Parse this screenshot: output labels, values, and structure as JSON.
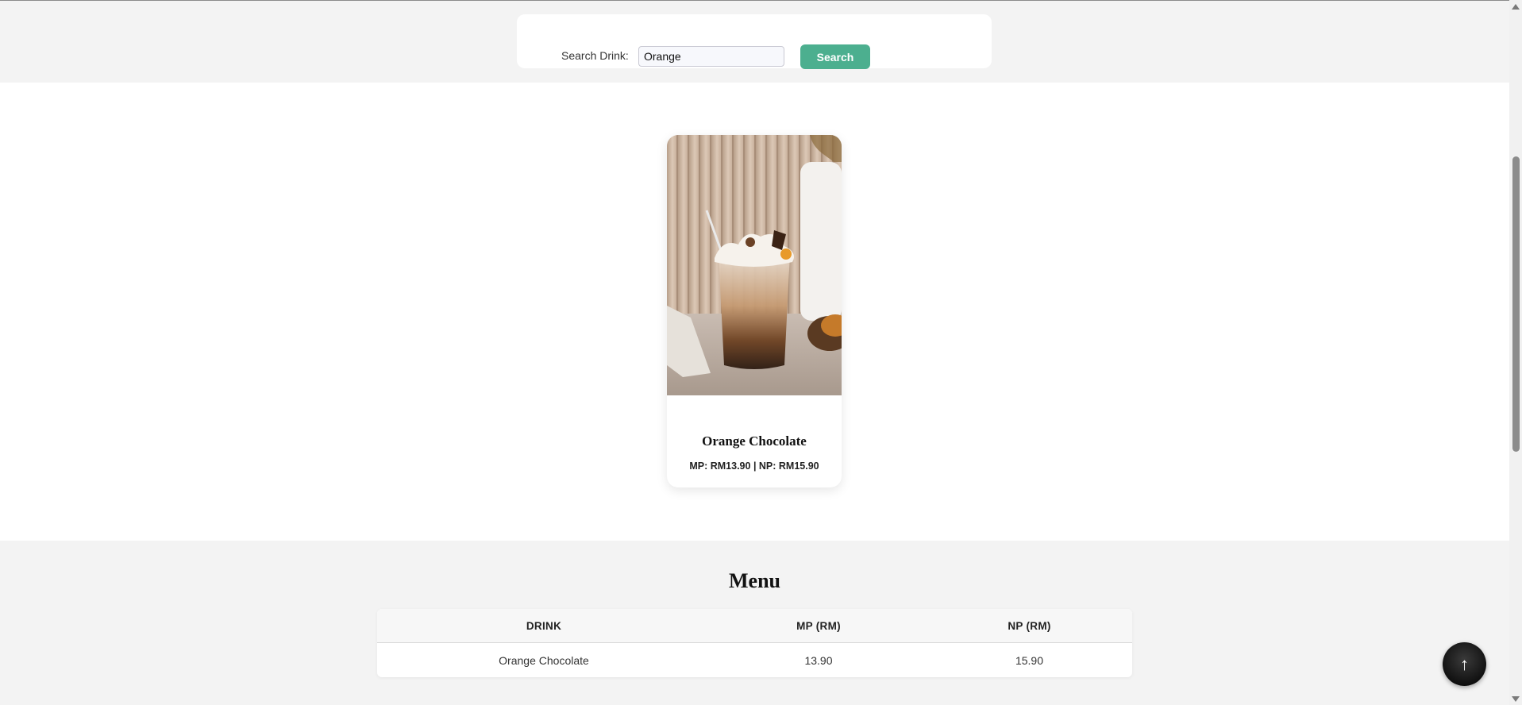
{
  "search": {
    "label": "Search Drink:",
    "value": "Orange",
    "button_label": "Search"
  },
  "product": {
    "name": "Orange Chocolate",
    "price_text": "MP: RM13.90 | NP: RM15.90"
  },
  "menu": {
    "title": "Menu",
    "columns": [
      "DRINK",
      "MP (RM)",
      "NP (RM)"
    ],
    "rows": [
      [
        "Orange Chocolate",
        "13.90",
        "15.90"
      ]
    ]
  },
  "back_to_top": {
    "glyph": "↑"
  },
  "colors": {
    "accent": "#4caf8f",
    "band": "#f3f3f3"
  }
}
